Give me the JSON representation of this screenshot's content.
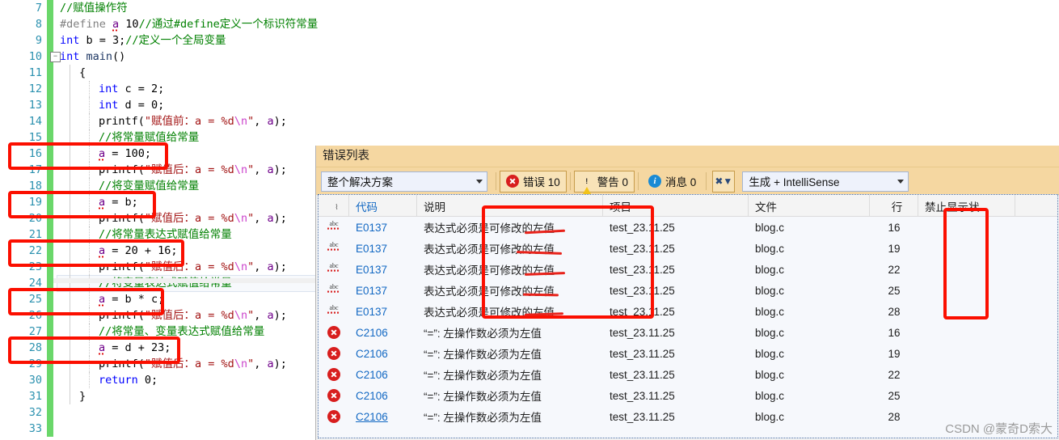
{
  "editor": {
    "lines": [
      {
        "num": "7",
        "indent": 0,
        "segments": [
          {
            "t": "//赋值操作符",
            "c": "com"
          }
        ]
      },
      {
        "num": "8",
        "indent": 0,
        "segments": [
          {
            "t": "#define ",
            "c": "pp"
          },
          {
            "t": "a",
            "c": "macro",
            "squig": true
          },
          {
            "t": " 10",
            "c": "plain"
          },
          {
            "t": "//通过#define定义一个标识符常量",
            "c": "com"
          }
        ]
      },
      {
        "num": "9",
        "indent": 0,
        "segments": [
          {
            "t": "int",
            "c": "kw"
          },
          {
            "t": " b = 3;",
            "c": "plain"
          },
          {
            "t": "//定义一个全局变量",
            "c": "com"
          }
        ]
      },
      {
        "num": "10",
        "indent": 0,
        "fold": true,
        "segments": [
          {
            "t": "int",
            "c": "kw"
          },
          {
            "t": " ",
            "c": "plain"
          },
          {
            "t": "main",
            "c": "var"
          },
          {
            "t": "()",
            "c": "plain"
          }
        ]
      },
      {
        "num": "11",
        "indent": 1,
        "segments": [
          {
            "t": "{",
            "c": "plain"
          }
        ]
      },
      {
        "num": "12",
        "indent": 2,
        "segments": [
          {
            "t": "int",
            "c": "kw"
          },
          {
            "t": " c = 2;",
            "c": "plain"
          }
        ]
      },
      {
        "num": "13",
        "indent": 2,
        "segments": [
          {
            "t": "int",
            "c": "kw"
          },
          {
            "t": " d = 0;",
            "c": "plain"
          }
        ]
      },
      {
        "num": "14",
        "indent": 2,
        "segments": [
          {
            "t": "printf(",
            "c": "plain"
          },
          {
            "t": "\"赋值前：a = %d",
            "c": "str"
          },
          {
            "t": "\\n",
            "c": "esc"
          },
          {
            "t": "\"",
            "c": "str"
          },
          {
            "t": ", ",
            "c": "plain"
          },
          {
            "t": "a",
            "c": "macro"
          },
          {
            "t": ");",
            "c": "plain"
          }
        ]
      },
      {
        "num": "15",
        "indent": 2,
        "segments": [
          {
            "t": "//将常量赋值给常量",
            "c": "com"
          }
        ]
      },
      {
        "num": "16",
        "indent": 2,
        "boxed": true,
        "segments": [
          {
            "t": "a",
            "c": "macro",
            "squig": true
          },
          {
            "t": " = 100;",
            "c": "plain"
          }
        ]
      },
      {
        "num": "17",
        "indent": 2,
        "segments": [
          {
            "t": "printf(",
            "c": "plain"
          },
          {
            "t": "\"赋值后：a = %d",
            "c": "str"
          },
          {
            "t": "\\n",
            "c": "esc"
          },
          {
            "t": "\"",
            "c": "str"
          },
          {
            "t": ", ",
            "c": "plain"
          },
          {
            "t": "a",
            "c": "macro"
          },
          {
            "t": ");",
            "c": "plain"
          }
        ]
      },
      {
        "num": "18",
        "indent": 2,
        "segments": [
          {
            "t": "//将变量赋值给常量",
            "c": "com"
          }
        ]
      },
      {
        "num": "19",
        "indent": 2,
        "boxed": true,
        "segments": [
          {
            "t": "a",
            "c": "macro",
            "squig": true
          },
          {
            "t": " = b;",
            "c": "plain"
          }
        ]
      },
      {
        "num": "20",
        "indent": 2,
        "segments": [
          {
            "t": "printf(",
            "c": "plain"
          },
          {
            "t": "\"赋值后：a = %d",
            "c": "str"
          },
          {
            "t": "\\n",
            "c": "esc"
          },
          {
            "t": "\"",
            "c": "str"
          },
          {
            "t": ", ",
            "c": "plain"
          },
          {
            "t": "a",
            "c": "macro"
          },
          {
            "t": ");",
            "c": "plain"
          }
        ]
      },
      {
        "num": "21",
        "indent": 2,
        "segments": [
          {
            "t": "//将常量表达式赋值给常量",
            "c": "com"
          }
        ]
      },
      {
        "num": "22",
        "indent": 2,
        "boxed": true,
        "segments": [
          {
            "t": "a",
            "c": "macro",
            "squig": true
          },
          {
            "t": " = 20 + 16;",
            "c": "plain"
          }
        ]
      },
      {
        "num": "23",
        "indent": 2,
        "segments": [
          {
            "t": "printf(",
            "c": "plain"
          },
          {
            "t": "\"赋值后：a = %d",
            "c": "str"
          },
          {
            "t": "\\n",
            "c": "esc"
          },
          {
            "t": "\"",
            "c": "str"
          },
          {
            "t": ", ",
            "c": "plain"
          },
          {
            "t": "a",
            "c": "macro"
          },
          {
            "t": ");",
            "c": "plain"
          }
        ]
      },
      {
        "num": "24",
        "indent": 2,
        "current": true,
        "segments": [
          {
            "t": "//将变量表达式赋值给常量",
            "c": "com"
          }
        ]
      },
      {
        "num": "25",
        "indent": 2,
        "boxed": true,
        "segments": [
          {
            "t": "a",
            "c": "macro",
            "squig": true
          },
          {
            "t": " = b * c;",
            "c": "plain"
          }
        ]
      },
      {
        "num": "26",
        "indent": 2,
        "segments": [
          {
            "t": "printf(",
            "c": "plain"
          },
          {
            "t": "\"赋值后：a = %d",
            "c": "str"
          },
          {
            "t": "\\n",
            "c": "esc"
          },
          {
            "t": "\"",
            "c": "str"
          },
          {
            "t": ", ",
            "c": "plain"
          },
          {
            "t": "a",
            "c": "macro"
          },
          {
            "t": ");",
            "c": "plain"
          }
        ]
      },
      {
        "num": "27",
        "indent": 2,
        "segments": [
          {
            "t": "//将常量、变量表达式赋值给常量",
            "c": "com"
          }
        ]
      },
      {
        "num": "28",
        "indent": 2,
        "boxed": true,
        "segments": [
          {
            "t": "a",
            "c": "macro",
            "squig": true
          },
          {
            "t": " = d + 23;",
            "c": "plain"
          }
        ]
      },
      {
        "num": "29",
        "indent": 2,
        "segments": [
          {
            "t": "printf(",
            "c": "plain"
          },
          {
            "t": "\"赋值后：a = %d",
            "c": "str"
          },
          {
            "t": "\\n",
            "c": "esc"
          },
          {
            "t": "\"",
            "c": "str"
          },
          {
            "t": ", ",
            "c": "plain"
          },
          {
            "t": "a",
            "c": "macro"
          },
          {
            "t": ");",
            "c": "plain"
          }
        ]
      },
      {
        "num": "30",
        "indent": 2,
        "segments": [
          {
            "t": "return",
            "c": "kw"
          },
          {
            "t": " 0;",
            "c": "plain"
          }
        ]
      },
      {
        "num": "31",
        "indent": 1,
        "segments": [
          {
            "t": "}",
            "c": "plain"
          }
        ]
      },
      {
        "num": "32",
        "indent": 0,
        "segments": []
      },
      {
        "num": "33",
        "indent": 0,
        "segments": []
      }
    ]
  },
  "error_list": {
    "title": "错误列表",
    "toolbar": {
      "scope_selected": "整个解决方案",
      "errors_label": "错误 10",
      "warnings_label": "警告 0",
      "messages_label": "消息 0",
      "filter_icon": "clear-filter-icon",
      "build_selected": "生成 + IntelliSense"
    },
    "columns": [
      {
        "key": "severity",
        "label": ""
      },
      {
        "key": "code",
        "label": "代码"
      },
      {
        "key": "description",
        "label": "说明"
      },
      {
        "key": "project",
        "label": "项目"
      },
      {
        "key": "file",
        "label": "文件"
      },
      {
        "key": "line",
        "label": "行"
      },
      {
        "key": "suppression",
        "label": "禁止显示状"
      }
    ],
    "rows": [
      {
        "severity": "intellisense",
        "code": "E0137",
        "description": "表达式必须是可修改的左值",
        "project": "test_23.11.25",
        "file": "blog.c",
        "line": "16",
        "suppression": ""
      },
      {
        "severity": "intellisense",
        "code": "E0137",
        "description": "表达式必须是可修改的左值",
        "project": "test_23.11.25",
        "file": "blog.c",
        "line": "19",
        "suppression": ""
      },
      {
        "severity": "intellisense",
        "code": "E0137",
        "description": "表达式必须是可修改的左值",
        "project": "test_23.11.25",
        "file": "blog.c",
        "line": "22",
        "suppression": ""
      },
      {
        "severity": "intellisense",
        "code": "E0137",
        "description": "表达式必须是可修改的左值",
        "project": "test_23.11.25",
        "file": "blog.c",
        "line": "25",
        "suppression": ""
      },
      {
        "severity": "intellisense",
        "code": "E0137",
        "description": "表达式必须是可修改的左值",
        "project": "test_23.11.25",
        "file": "blog.c",
        "line": "28",
        "suppression": ""
      },
      {
        "severity": "error",
        "code": "C2106",
        "description": "“=”: 左操作数必须为左值",
        "project": "test_23.11.25",
        "file": "blog.c",
        "line": "16",
        "suppression": ""
      },
      {
        "severity": "error",
        "code": "C2106",
        "description": "“=”: 左操作数必须为左值",
        "project": "test_23.11.25",
        "file": "blog.c",
        "line": "19",
        "suppression": ""
      },
      {
        "severity": "error",
        "code": "C2106",
        "description": "“=”: 左操作数必须为左值",
        "project": "test_23.11.25",
        "file": "blog.c",
        "line": "22",
        "suppression": ""
      },
      {
        "severity": "error",
        "code": "C2106",
        "description": "“=”: 左操作数必须为左值",
        "project": "test_23.11.25",
        "file": "blog.c",
        "line": "25",
        "suppression": ""
      },
      {
        "severity": "error",
        "code": "C2106",
        "description": "“=”: 左操作数必须为左值",
        "project": "test_23.11.25",
        "file": "blog.c",
        "line": "28",
        "suppression": "",
        "linked": true
      }
    ]
  },
  "watermark": "CSDN @蒙奇D索大",
  "colors": {
    "annotation_red": "#fb0f00",
    "change_bar_green": "#6ad76a",
    "panel_header": "#f5d7a1",
    "link_blue": "#1268c3",
    "line_number": "#2b91af"
  }
}
